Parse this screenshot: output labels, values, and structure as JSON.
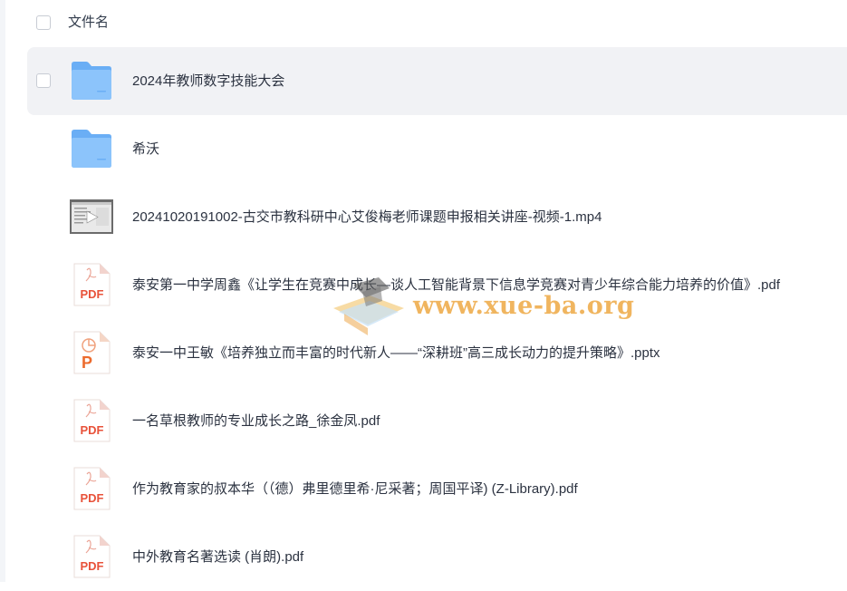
{
  "header": {
    "column_label": "文件名"
  },
  "files": [
    {
      "name": "2024年教师数字技能大会",
      "type": "folder",
      "icon": "folder-icon",
      "selected": true
    },
    {
      "name": "希沃",
      "type": "folder",
      "icon": "folder-icon",
      "selected": false
    },
    {
      "name": "20241020191002-古交市教科研中心艾俊梅老师课题申报相关讲座-视频-1.mp4",
      "type": "video",
      "icon": "video-thumbnail-icon",
      "selected": false
    },
    {
      "name": "泰安第一中学周鑫《让学生在竞赛中成长—谈人工智能背景下信息学竞赛对青少年综合能力培养的价值》.pdf",
      "type": "pdf",
      "icon": "pdf-icon",
      "selected": false
    },
    {
      "name": "泰安一中王敏《培养独立而丰富的时代新人——“深耕班”高三成长动力的提升策略》.pptx",
      "type": "pptx",
      "icon": "pptx-icon",
      "selected": false
    },
    {
      "name": "一名草根教师的专业成长之路_徐金凤.pdf",
      "type": "pdf",
      "icon": "pdf-icon",
      "selected": false
    },
    {
      "name": "作为教育家的叔本华（（德）弗里德里希·尼采著；周国平译) (Z-Library).pdf",
      "type": "pdf",
      "icon": "pdf-icon",
      "selected": false
    },
    {
      "name": "中外教育名著选读 (肖朗).pdf",
      "type": "pdf",
      "icon": "pdf-icon",
      "selected": false
    }
  ],
  "icon_labels": {
    "pdf": "PDF",
    "pptx": "P"
  },
  "watermark": {
    "text": "www.xue-ba.org"
  },
  "colors": {
    "folder": "#6aaef5",
    "folder_light": "#8cc4fb",
    "pdf": "#e8523a",
    "pptx": "#ec6b2d",
    "selected_row": "#f1f2f5",
    "text": "#2b3240"
  }
}
